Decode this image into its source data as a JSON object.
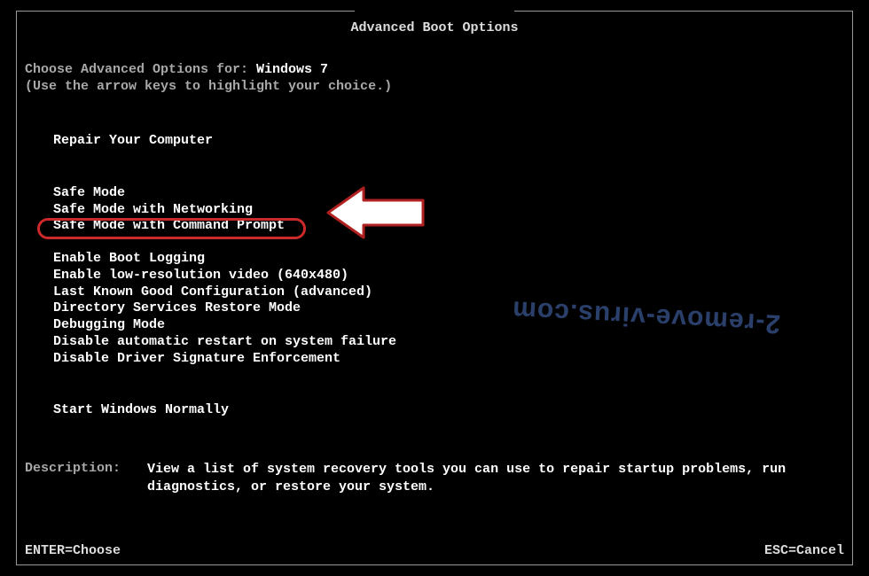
{
  "title": "Advanced Boot Options",
  "prompt_prefix": "Choose Advanced Options for: ",
  "os_name": "Windows 7",
  "hint": "(Use the arrow keys to highlight your choice.)",
  "groups": {
    "repair": "Repair Your Computer",
    "safe": [
      "Safe Mode",
      "Safe Mode with Networking",
      "Safe Mode with Command Prompt"
    ],
    "advanced": [
      "Enable Boot Logging",
      "Enable low-resolution video (640x480)",
      "Last Known Good Configuration (advanced)",
      "Directory Services Restore Mode",
      "Debugging Mode",
      "Disable automatic restart on system failure",
      "Disable Driver Signature Enforcement"
    ],
    "normal": "Start Windows Normally"
  },
  "description": {
    "label": "Description:",
    "text": "View a list of system recovery tools you can use to repair startup problems, run diagnostics, or restore your system."
  },
  "footer": {
    "enter": "ENTER=Choose",
    "esc": "ESC=Cancel"
  },
  "watermark": "2-remove-virus.com"
}
